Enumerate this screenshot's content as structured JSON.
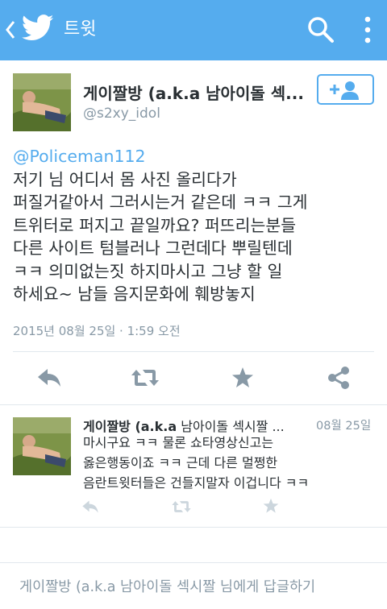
{
  "header": {
    "title": "트윗"
  },
  "tweet": {
    "author_name": "게이짤방 (a.k.a 남아이돌 섹...",
    "author_handle": "@s2xy_idol",
    "mention": "@Policeman112",
    "lines": [
      "저기 님 어디서 몸 사진 올리다가",
      "퍼질거같아서 그러시는거 같은데 ㅋㅋ 그게",
      "트위터로 퍼지고 끝일까요? 퍼뜨리는분들",
      "다른 사이트 텀블러나 그런데다 뿌릴텐데",
      "ㅋㅋ 의미없는짓 하지마시고 그냥 할 일",
      "하세요~ 남들 음지문화에 훼방놓지"
    ],
    "timestamp": "2015년 08월 25일 · 1:59 오전"
  },
  "reply": {
    "author_name_bold": "게이짤방 (a.k.a",
    "author_name_rest": " 남아이돌 섹시짤 ...",
    "date": "08월 25일",
    "lines": [
      "마시구요 ㅋㅋ 물론 쇼타영상신고는",
      "옳은행동이죠 ㅋㅋ 근데 다른 멀쩡한",
      "음란트윗터들은 건들지말자 이겁니다 ㅋㅋ"
    ]
  },
  "compose": {
    "placeholder": "게이짤방 (a.k.a 남아이돌 섹시짤 님에게 답글하기"
  },
  "icons": {
    "back": "chevron-left-icon",
    "logo": "twitter-bird-icon",
    "search": "search-icon",
    "more": "more-vertical-icon",
    "follow": "add-user-icon",
    "reply": "reply-icon",
    "retweet": "retweet-icon",
    "favorite": "star-icon",
    "share": "share-icon"
  },
  "colors": {
    "brand": "#55acee",
    "action_gray": "#8899a6",
    "action_light": "#ccd6dd",
    "text": "#292f33"
  }
}
